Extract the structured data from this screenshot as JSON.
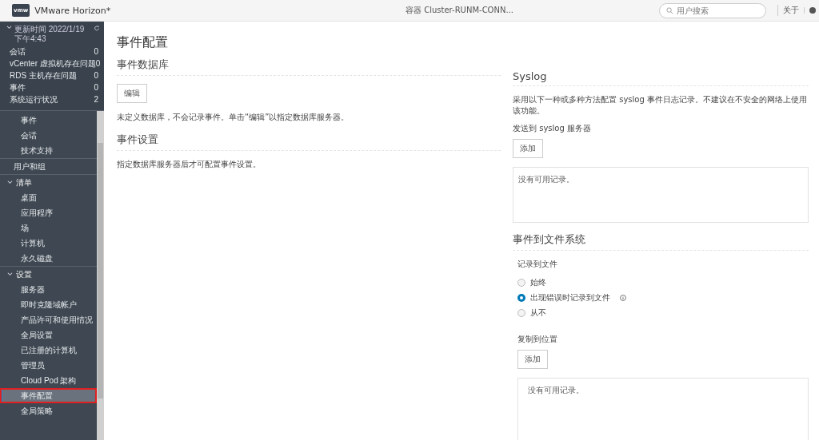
{
  "header": {
    "logo": "vmw",
    "product": "VMware Horizon*",
    "pod": "容器 Cluster-RUNM-CONN...",
    "search": {
      "placeholder": "用户搜索"
    },
    "about": "关于"
  },
  "summary": {
    "title": "更新时间 2022/1/19 下午4:43",
    "expanded": true,
    "rows": [
      {
        "label": "会话",
        "count": "0"
      },
      {
        "label": "vCenter 虚拟机存在问题",
        "count": "0"
      },
      {
        "label": "RDS 主机存在问题",
        "count": "0"
      },
      {
        "label": "事件",
        "count": "0"
      },
      {
        "label": "系统运行状况",
        "count": "2"
      }
    ]
  },
  "nav": [
    {
      "children": [
        {
          "label": "事件",
          "selected": false
        },
        {
          "label": "会话",
          "selected": false
        },
        {
          "label": "技术支持",
          "selected": false
        }
      ]
    },
    {
      "label": "用户和组",
      "selected": false
    },
    {
      "label": "清单",
      "expanded": true,
      "children": [
        {
          "label": "桌面",
          "selected": false
        },
        {
          "label": "应用程序",
          "selected": false
        },
        {
          "label": "场",
          "selected": false
        },
        {
          "label": "计算机",
          "selected": false
        },
        {
          "label": "永久磁盘",
          "selected": false
        }
      ]
    },
    {
      "label": "设置",
      "expanded": true,
      "children": [
        {
          "label": "服务器",
          "selected": false
        },
        {
          "label": "即时克隆域帐户",
          "selected": false
        },
        {
          "label": "产品许可和使用情况",
          "selected": false
        },
        {
          "label": "全局设置",
          "selected": false
        },
        {
          "label": "已注册的计算机",
          "selected": false
        },
        {
          "label": "管理员",
          "selected": false
        },
        {
          "label": "Cloud Pod 架构",
          "selected": false
        },
        {
          "label": "事件配置",
          "selected": true
        },
        {
          "label": "全局策略",
          "selected": false
        }
      ]
    }
  ],
  "page": {
    "title": "事件配置",
    "left": [
      {
        "heading": "事件数据库",
        "button": "编辑",
        "text": "未定义数据库，不会记录事件。单击“编辑”以指定数据库服务器。"
      },
      {
        "heading": "事件设置",
        "text": "指定数据库服务器后才可配置事件设置。"
      }
    ],
    "syslog": {
      "heading": "Syslog",
      "text": "采用以下一种或多种方法配置 syslog 事件日志记录。不建议在不安全的网络上使用该功能。",
      "label": "发送到 syslog 服务器",
      "button": "添加",
      "empty": "没有可用记录。"
    },
    "file": {
      "heading": "事件到文件系统",
      "label": "记录到文件",
      "options": [
        {
          "label": "始终",
          "selected": false
        },
        {
          "label": "出现错误时记录到文件",
          "selected": true,
          "info": true
        },
        {
          "label": "从不",
          "selected": false
        }
      ],
      "copy_label": "复制到位置",
      "button": "添加",
      "empty": "没有可用记录。"
    }
  }
}
